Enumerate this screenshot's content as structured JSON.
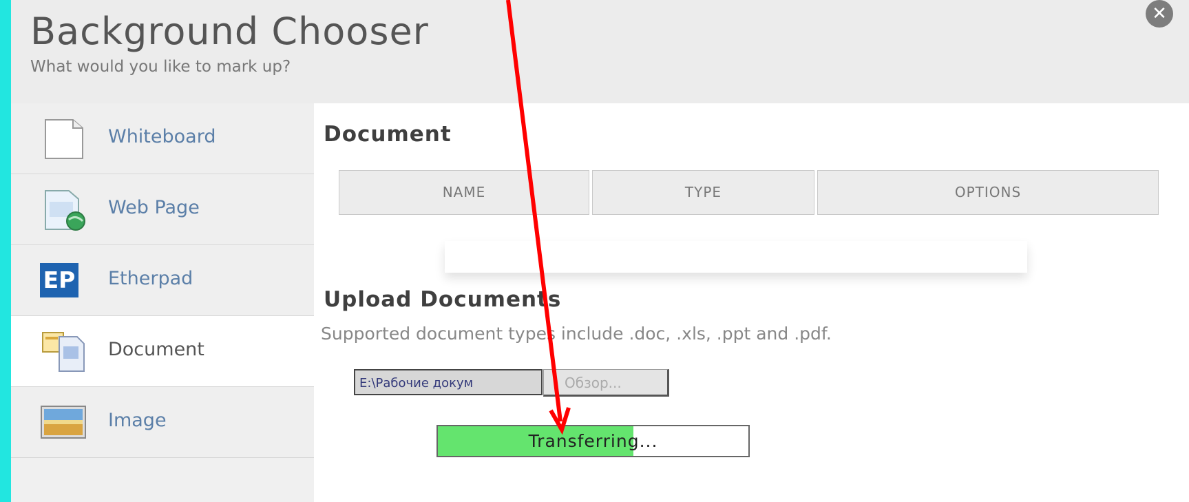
{
  "dialog": {
    "title": "Background Chooser",
    "subtitle": "What would you like to mark up?",
    "close_icon": "close-icon"
  },
  "sidebar": {
    "items": [
      {
        "label": "Whiteboard",
        "icon": "whiteboard-icon"
      },
      {
        "label": "Web Page",
        "icon": "web-page-icon"
      },
      {
        "label": "Etherpad",
        "icon": "etherpad-icon",
        "icon_text": "EP"
      },
      {
        "label": "Document",
        "icon": "document-icon",
        "active": true
      },
      {
        "label": "Image",
        "icon": "image-icon"
      }
    ]
  },
  "document_section": {
    "heading": "Document",
    "columns": [
      "NAME",
      "TYPE",
      "OPTIONS"
    ]
  },
  "upload_section": {
    "heading": "Upload Documents",
    "supported_text": "Supported document types include .doc, .xls, .ppt and .pdf.",
    "file_value": "E:\\Рабочие докум",
    "browse_label": "Обзор...",
    "progress_label": "Transferring...",
    "progress_fraction": 0.63
  },
  "colors": {
    "background": "#22e6e0",
    "progress_fill": "#64e46e",
    "arrow": "#ff0000",
    "link": "#5b7fa8"
  }
}
